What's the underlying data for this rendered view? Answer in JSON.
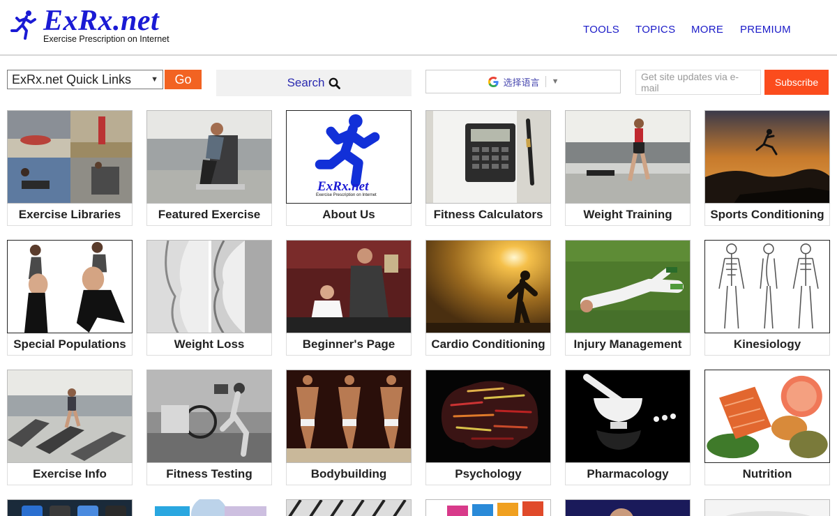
{
  "header": {
    "logo_title": "ExRx.net",
    "logo_subtitle": "Exercise Prescription on Internet",
    "nav": [
      "TOOLS",
      "TOPICS",
      "MORE",
      "PREMIUM"
    ]
  },
  "toolbar": {
    "quick_links_value": "ExRx.net Quick Links",
    "go_label": "Go",
    "search_label": "Search",
    "translate_label": "选择语言",
    "email_placeholder": "Get site updates via e-mail",
    "subscribe_label": "Subscribe"
  },
  "about_tile": {
    "logo_title": "ExRx.net",
    "logo_subtitle": "Exercise Prescription on Internet"
  },
  "tiles": [
    {
      "label": "Exercise Libraries"
    },
    {
      "label": "Featured Exercise"
    },
    {
      "label": "About Us"
    },
    {
      "label": "Fitness Calculators"
    },
    {
      "label": "Weight Training"
    },
    {
      "label": "Sports Conditioning"
    },
    {
      "label": "Special Populations"
    },
    {
      "label": "Weight Loss"
    },
    {
      "label": "Beginner's Page"
    },
    {
      "label": "Cardio Conditioning"
    },
    {
      "label": "Injury Management"
    },
    {
      "label": "Kinesiology"
    },
    {
      "label": "Exercise Info"
    },
    {
      "label": "Fitness Testing"
    },
    {
      "label": "Bodybuilding"
    },
    {
      "label": "Psychology"
    },
    {
      "label": "Pharmacology"
    },
    {
      "label": "Nutrition"
    }
  ],
  "colors": {
    "brand_blue": "#1a1ad4",
    "nav_blue": "#1a1ac8",
    "go_orange": "#f26322",
    "subscribe_orange": "#fb4c1d"
  }
}
